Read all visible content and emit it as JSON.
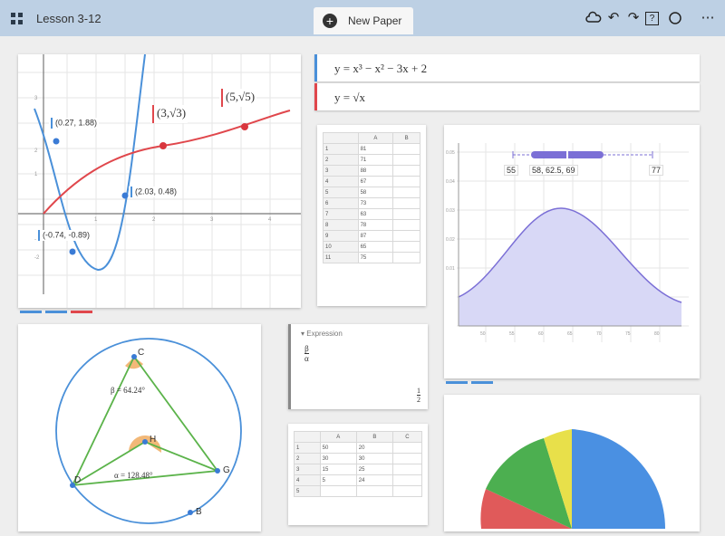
{
  "app": {
    "lesson_title": "Lesson 3-12",
    "tab_label": "New Paper",
    "tab_add": "+",
    "tools": {
      "undo": "↶",
      "redo": "↷",
      "help": "?",
      "more": "⋯"
    }
  },
  "graph": {
    "points": [
      {
        "label": "(0.27, 1.88)"
      },
      {
        "label": "(2.03, 0.48)"
      },
      {
        "label": "(-0.74, -0.89)"
      }
    ],
    "curve_labels": [
      "(3,√3)",
      "(5,√5)"
    ],
    "colors": {
      "parabola": "#4a90d9",
      "sqrt": "#e0474c"
    }
  },
  "expressions": [
    {
      "text": "y = x³ − x² − 3x + 2",
      "color": "#4a90d9"
    },
    {
      "text": "y = √x",
      "color": "#e0474c"
    }
  ],
  "spreadsheet_1": {
    "columns": [
      "",
      "A",
      "B"
    ],
    "rows": [
      [
        "1",
        "81",
        ""
      ],
      [
        "2",
        "71",
        ""
      ],
      [
        "3",
        "88",
        ""
      ],
      [
        "4",
        "67",
        ""
      ],
      [
        "5",
        "58",
        ""
      ],
      [
        "6",
        "73",
        ""
      ],
      [
        "7",
        "63",
        ""
      ],
      [
        "8",
        "78",
        ""
      ],
      [
        "9",
        "87",
        ""
      ],
      [
        "10",
        "65",
        ""
      ],
      [
        "11",
        "75",
        ""
      ]
    ]
  },
  "distribution": {
    "box_labels": [
      "55",
      "58, 62.5, 69",
      "77"
    ],
    "colors": {
      "fill": "#d8d8f6",
      "line": "#7b6fd6",
      "box": "#7b6fd6"
    }
  },
  "geometry": {
    "vertices": [
      "C",
      "H",
      "D",
      "G",
      "B"
    ],
    "angle_labels": [
      "β = 64.24°",
      "α = 128.48°"
    ],
    "colors": {
      "circle": "#4a90d9",
      "triangle": "#5bb34a",
      "angle": "#f2b878"
    }
  },
  "expression_card": {
    "header": "Expression",
    "fraction_num": "β",
    "fraction_den": "α",
    "result_num": "1",
    "result_den": "2"
  },
  "spreadsheet_2": {
    "columns": [
      "",
      "A",
      "B",
      "C"
    ],
    "rows": [
      [
        "1",
        "50",
        "20",
        ""
      ],
      [
        "2",
        "30",
        "30",
        ""
      ],
      [
        "3",
        "15",
        "25",
        ""
      ],
      [
        "4",
        "5",
        "24",
        ""
      ],
      [
        "5",
        "",
        "",
        ""
      ]
    ]
  },
  "pie": {
    "colors": [
      "#4a90e2",
      "#e05a5a",
      "#4caf50",
      "#e8e04a"
    ]
  }
}
